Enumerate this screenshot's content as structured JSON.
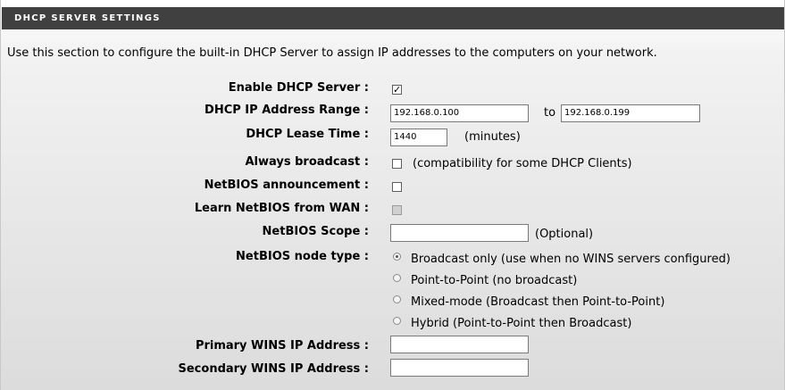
{
  "section": {
    "title": "DHCP SERVER SETTINGS",
    "description": "Use this section to configure the built-in DHCP Server to assign IP addresses to the computers on your network."
  },
  "fields": {
    "enable_dhcp": {
      "label": "Enable DHCP Server :",
      "checked": true
    },
    "ip_range": {
      "label": "DHCP IP Address Range :",
      "start": "192.168.0.100",
      "to_label": "to",
      "end": "192.168.0.199"
    },
    "lease_time": {
      "label": "DHCP Lease Time :",
      "value": "1440",
      "unit": "(minutes)"
    },
    "always_broadcast": {
      "label": "Always broadcast :",
      "checked": false,
      "note": "(compatibility for some DHCP Clients)"
    },
    "netbios_announcement": {
      "label": "NetBIOS announcement :",
      "checked": false
    },
    "learn_netbios_wan": {
      "label": "Learn NetBIOS from WAN :",
      "checked": false,
      "disabled": true
    },
    "netbios_scope": {
      "label": "NetBIOS Scope :",
      "value": "",
      "note": "(Optional)"
    },
    "netbios_node_type": {
      "label": "NetBIOS node type :",
      "options": [
        {
          "label": "Broadcast only (use when no WINS servers configured)",
          "selected": true
        },
        {
          "label": "Point-to-Point (no broadcast)",
          "selected": false
        },
        {
          "label": "Mixed-mode (Broadcast then Point-to-Point)",
          "selected": false
        },
        {
          "label": "Hybrid (Point-to-Point then Broadcast)",
          "selected": false
        }
      ]
    },
    "primary_wins": {
      "label": "Primary WINS IP Address :",
      "value": ""
    },
    "secondary_wins": {
      "label": "Secondary WINS IP Address :",
      "value": ""
    }
  }
}
